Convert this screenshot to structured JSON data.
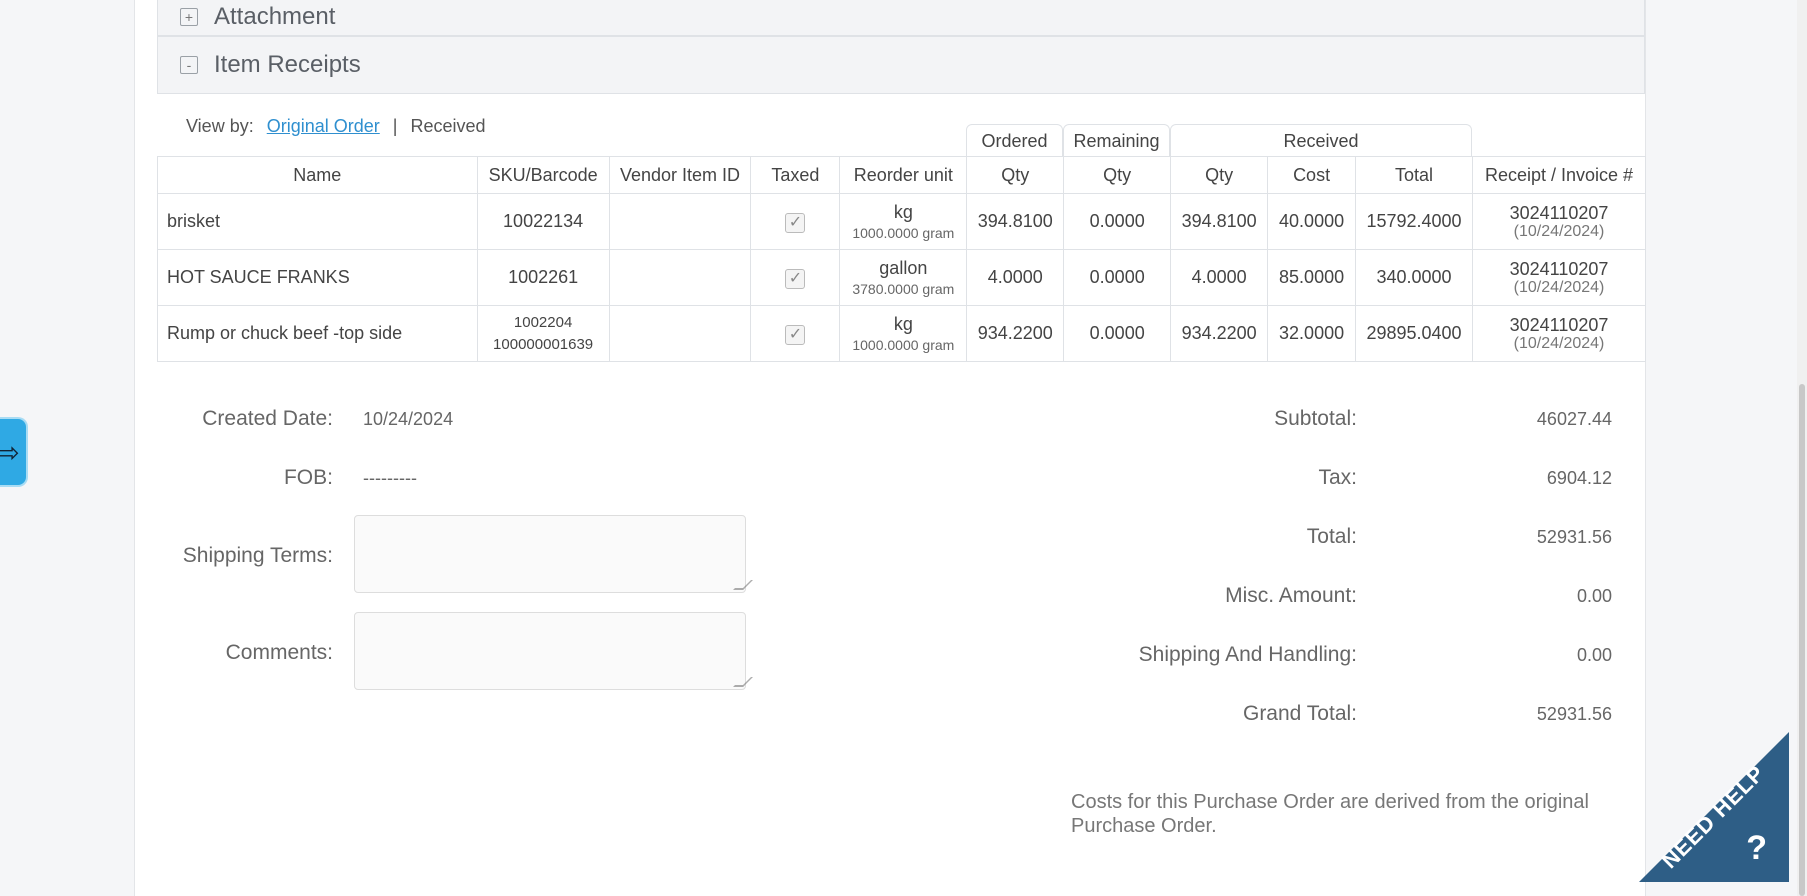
{
  "sections": {
    "attachment": {
      "title": "Attachment",
      "toggle": "+"
    },
    "item_receipts": {
      "title": "Item Receipts",
      "toggle": "-"
    }
  },
  "view_by": {
    "label": "View by:",
    "original_order": "Original Order",
    "separator": "|",
    "received": "Received"
  },
  "group_headers": {
    "ordered": "Ordered",
    "remaining": "Remaining",
    "received": "Received"
  },
  "columns": [
    "Name",
    "SKU/Barcode",
    "Vendor Item ID",
    "Taxed",
    "Reorder unit",
    "Qty",
    "Qty",
    "Qty",
    "Cost",
    "Total",
    "Receipt / Invoice #"
  ],
  "rows": [
    {
      "name": "brisket",
      "sku": "10022134",
      "sku2": "",
      "vendor_item_id": "",
      "taxed": true,
      "unit": "kg",
      "unit_sub": "1000.0000 gram",
      "ordered_qty": "394.8100",
      "remaining_qty": "0.0000",
      "received_qty": "394.8100",
      "cost": "40.0000",
      "total": "15792.4000",
      "invoice": "3024110207",
      "invoice_date": "(10/24/2024)"
    },
    {
      "name": "HOT SAUCE FRANKS",
      "sku": "1002261",
      "sku2": "",
      "vendor_item_id": "",
      "taxed": true,
      "unit": "gallon",
      "unit_sub": "3780.0000 gram",
      "ordered_qty": "4.0000",
      "remaining_qty": "0.0000",
      "received_qty": "4.0000",
      "cost": "85.0000",
      "total": "340.0000",
      "invoice": "3024110207",
      "invoice_date": "(10/24/2024)"
    },
    {
      "name": "Rump or chuck beef -top side",
      "sku": "1002204",
      "sku2": "100000001639",
      "vendor_item_id": "",
      "taxed": true,
      "unit": "kg",
      "unit_sub": "1000.0000 gram",
      "ordered_qty": "934.2200",
      "remaining_qty": "0.0000",
      "received_qty": "934.2200",
      "cost": "32.0000",
      "total": "29895.0400",
      "invoice": "3024110207",
      "invoice_date": "(10/24/2024)"
    }
  ],
  "form": {
    "created_date_label": "Created Date:",
    "created_date": "10/24/2024",
    "fob_label": "FOB:",
    "fob": "---------",
    "shipping_terms_label": "Shipping Terms:",
    "comments_label": "Comments:"
  },
  "summary": {
    "subtotal_label": "Subtotal:",
    "subtotal": "46027.44",
    "tax_label": "Tax:",
    "tax": "6904.12",
    "total_label": "Total:",
    "total": "52931.56",
    "misc_label": "Misc. Amount:",
    "misc": "0.00",
    "shipping_label": "Shipping And Handling:",
    "shipping": "0.00",
    "grand_total_label": "Grand Total:",
    "grand_total": "52931.56"
  },
  "note": "Costs for this Purchase Order are derived from the original Purchase Order.",
  "need_help": {
    "label": "NEED HELP",
    "icon": "?"
  },
  "side_tab_icon": "⇨"
}
